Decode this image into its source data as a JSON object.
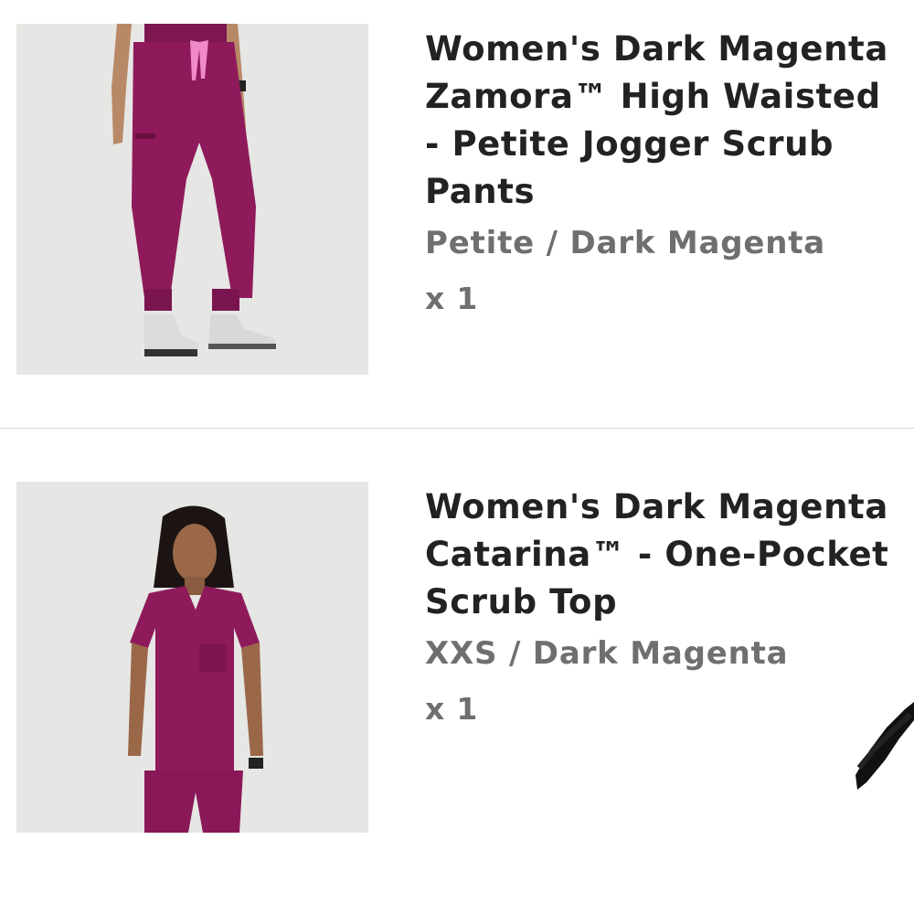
{
  "cart": {
    "items": [
      {
        "title": "Women's Dark Magenta Zamora™ High Waisted - Petite Jogger Scrub Pants",
        "variant": "Petite / Dark Magenta",
        "quantity": "x 1",
        "image_alt": "product-photo-jogger-pants"
      },
      {
        "title": "Women's Dark Magenta Catarina™ - One-Pocket Scrub Top",
        "variant": "XXS / Dark Magenta",
        "quantity": "x 1",
        "image_alt": "product-photo-scrub-top"
      }
    ]
  },
  "colors": {
    "product_magenta": "#8f1a5b",
    "title_text": "#222222",
    "secondary_text": "#6f6f6f",
    "divider": "#d6d6d6",
    "photo_background": "#e6e6e4"
  }
}
